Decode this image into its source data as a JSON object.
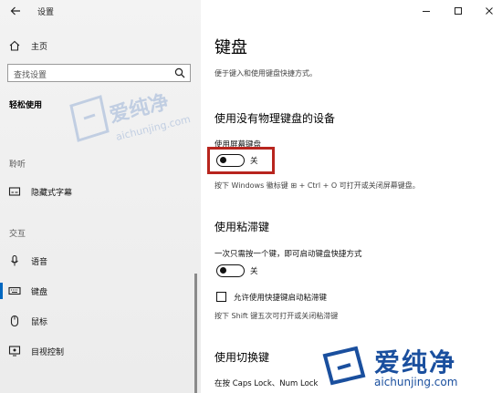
{
  "app": {
    "title": "设置"
  },
  "sidebar": {
    "home": "主页",
    "search_placeholder": "查找设置",
    "category": "轻松使用",
    "sections": {
      "hearing": "聆听",
      "interaction": "交互"
    },
    "items": {
      "captions": "隐藏式字幕",
      "speech": "语音",
      "keyboard": "键盘",
      "mouse": "鼠标",
      "eye_control": "目视控制"
    }
  },
  "main": {
    "title": "键盘",
    "description": "便于键入和使用键盘快捷方式。",
    "osk": {
      "heading": "使用没有物理键盘的设备",
      "toggle_label": "使用屏幕键盘",
      "toggle_state": "关",
      "hint": "按下 Windows 徽标键 ⊞ + Ctrl + O 可打开或关闭屏幕键盘。"
    },
    "sticky": {
      "heading": "使用粘滞键",
      "toggle_label": "一次只需按一个键，即可启动键盘快捷方式",
      "toggle_state": "关",
      "checkbox_label": "允许使用快捷键启动粘滞键",
      "hint": "按下 Shift 键五次可打开或关闭粘滞键"
    },
    "toggle_keys": {
      "heading": "使用切换键",
      "partial_text": "在按 Caps Lock、Num Lock"
    }
  },
  "watermark": {
    "brand": "爱纯净",
    "url": "aichunjing.com"
  },
  "colors": {
    "accent": "#0067c0",
    "highlight": "#b8251e"
  }
}
